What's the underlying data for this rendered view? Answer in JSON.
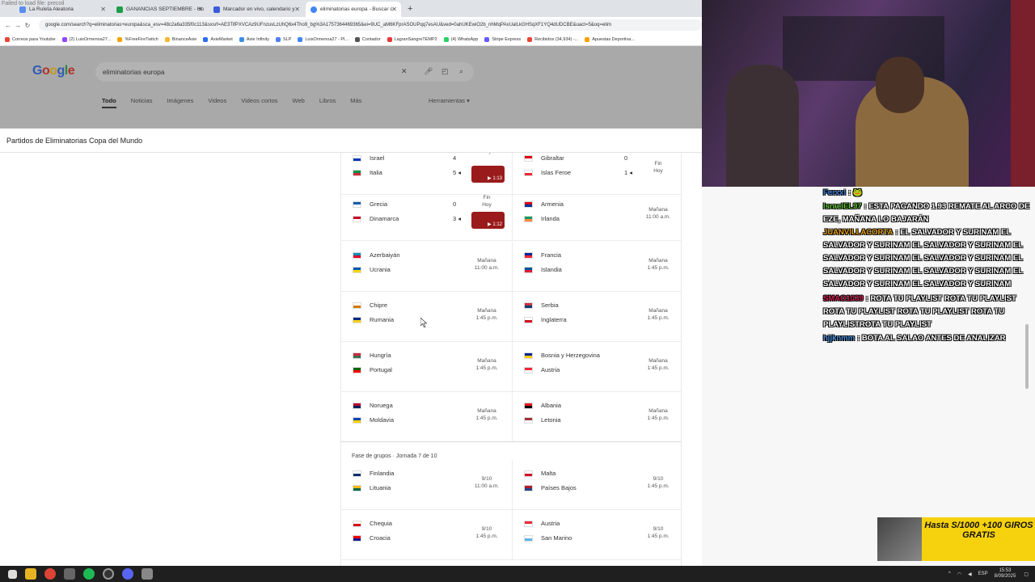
{
  "browser": {
    "failed_notice": "Failed to load file: precoil",
    "tabs": [
      {
        "label": "La Ruleta Aleatoria",
        "color": "#5b8def"
      },
      {
        "label": "GANANCIAS SEPTIEMBRE - Ho",
        "color": "#1e9e4a"
      },
      {
        "label": "Marcador en vivo, calendario y",
        "color": "#3b5bdb"
      },
      {
        "label": "eliminatorias europa - Buscar c",
        "color": "#4285f4"
      }
    ],
    "new_tab": "+",
    "url": "google.com/search?q=eliminatorias+europa&sca_esv=48c2a6a335f0c113&sxsrf=AE3TifPXVCAz9UFnzuvLzUhQ6x4Tho9_bg%3A1757364469365&ei=9UC_aM6KFprASOUPqq7esAU&ved=0ahUKEwiO2b_nhMqPAxUalLkGHSqXF1YQ4dUDCBE&uact=5&oq=elim",
    "bookmarks": [
      {
        "label": "Correos para Youtube",
        "color": "#ea4335"
      },
      {
        "label": "(2) LuisOrmenoa27...",
        "color": "#9146ff"
      },
      {
        "label": "%FreeFireTwitch",
        "color": "#f4a300"
      },
      {
        "label": "BinanceAxie",
        "color": "#f3ba2f"
      },
      {
        "label": "AxieMarket",
        "color": "#2a6df4"
      },
      {
        "label": "Axie Infinity",
        "color": "#3a8ee6"
      },
      {
        "label": "SLP",
        "color": "#4f7ff0"
      },
      {
        "label": "LuisOrmenoa27 - Pl...",
        "color": "#4285f4"
      },
      {
        "label": "Contador",
        "color": "#555555"
      },
      {
        "label": "LagranSangreTEMP2",
        "color": "#e53935"
      },
      {
        "label": "(4) WhatsApp",
        "color": "#25d366"
      },
      {
        "label": "Stripe Express",
        "color": "#635bff"
      },
      {
        "label": "Recibidos (34,934) -...",
        "color": "#ea4335"
      },
      {
        "label": "Apuestas Deportiva...",
        "color": "#f4a300"
      }
    ]
  },
  "google": {
    "logo": "Google",
    "query": "eliminatorias europa",
    "tabs": [
      "Todo",
      "Noticias",
      "Imágenes",
      "Videos",
      "Videos cortos",
      "Web",
      "Libros",
      "Más"
    ],
    "tools": "Herramientas ▾",
    "panel_title": "Partidos de Eliminatorias Copa del Mundo",
    "phase_label": "Fase de grupos · Jornada 7 de 10",
    "matches": [
      {
        "left": {
          "t1": "Israel",
          "f1": [
            "#ffffff",
            "#0038b8"
          ],
          "s1": "4",
          "t2": "Italia",
          "f2": [
            "#009246",
            "#ce2b37"
          ],
          "s2": "5 ◂",
          "time": "Hoy",
          "thumb": "▶ 1:13"
        },
        "right": {
          "t1": "Gibraltar",
          "f1": [
            "#da000c",
            "#ffffff"
          ],
          "s1": "0",
          "t2": "Islas Feroe",
          "f2": [
            "#ffffff",
            "#ed2939"
          ],
          "s2": "1 ◂",
          "time": "Fin\nHoy"
        }
      },
      {
        "left": {
          "t1": "Grecia",
          "f1": [
            "#0d5eaf",
            "#ffffff"
          ],
          "s1": "0",
          "t2": "Dinamarca",
          "f2": [
            "#c8102e",
            "#ffffff"
          ],
          "s2": "3 ◂",
          "time": "Fin\nHoy",
          "thumb": "▶ 1:12"
        },
        "right": {
          "t1": "Armenia",
          "f1": [
            "#d90012",
            "#0033a0"
          ],
          "t2": "Irlanda",
          "f2": [
            "#169b62",
            "#ff883e"
          ],
          "time": "Mañana\n11:00 a.m."
        }
      },
      {
        "left": {
          "t1": "Azerbaiyán",
          "f1": [
            "#0092bc",
            "#e4002b"
          ],
          "t2": "Ucrania",
          "f2": [
            "#0057b7",
            "#ffd700"
          ],
          "time": "Mañana\n11:00 a.m."
        },
        "right": {
          "t1": "Francia",
          "f1": [
            "#002395",
            "#ed2939"
          ],
          "t2": "Islandia",
          "f2": [
            "#02529c",
            "#dc1e35"
          ],
          "time": "Mañana\n1:45 p.m."
        }
      },
      {
        "left": {
          "t1": "Chipre",
          "f1": [
            "#ffffff",
            "#d57800"
          ],
          "t2": "Rumania",
          "f2": [
            "#002b7f",
            "#fcd116"
          ],
          "time": "Mañana\n1:45 p.m."
        },
        "right": {
          "t1": "Serbia",
          "f1": [
            "#c6363c",
            "#0c4076"
          ],
          "t2": "Inglaterra",
          "f2": [
            "#ffffff",
            "#ce1124"
          ],
          "time": "Mañana\n1:45 p.m."
        }
      },
      {
        "left": {
          "t1": "Hungría",
          "f1": [
            "#cd2a3e",
            "#436f4d"
          ],
          "t2": "Portugal",
          "f2": [
            "#006600",
            "#ff0000"
          ],
          "time": "Mañana\n1:45 p.m."
        },
        "right": {
          "t1": "Bosnia y Herzegovina",
          "f1": [
            "#002395",
            "#fecb00"
          ],
          "t2": "Austria",
          "f2": [
            "#ed2939",
            "#ffffff"
          ],
          "time": "Mañana\n1:45 p.m."
        }
      },
      {
        "left": {
          "t1": "Noruega",
          "f1": [
            "#ba0c2f",
            "#00205b"
          ],
          "t2": "Moldavia",
          "f2": [
            "#0046ae",
            "#ffd200"
          ],
          "time": "Mañana\n1:45 p.m."
        },
        "right": {
          "t1": "Albania",
          "f1": [
            "#e41e20",
            "#000000"
          ],
          "t2": "Letonia",
          "f2": [
            "#9e3039",
            "#ffffff"
          ],
          "time": "Mañana\n1:45 p.m."
        }
      },
      {
        "left": {
          "t1": "Finlandia",
          "f1": [
            "#ffffff",
            "#002f6c"
          ],
          "t2": "Lituania",
          "f2": [
            "#fdb913",
            "#006a44"
          ],
          "time": "9/10\n11:00 a.m."
        },
        "right": {
          "t1": "Malta",
          "f1": [
            "#ffffff",
            "#cf142b"
          ],
          "t2": "Países Bajos",
          "f2": [
            "#ae1c28",
            "#21468b"
          ],
          "time": "9/10\n1:45 p.m."
        }
      },
      {
        "left": {
          "t1": "Chequia",
          "f1": [
            "#ffffff",
            "#d7141a"
          ],
          "t2": "Croacia",
          "f2": [
            "#ff0000",
            "#171796"
          ],
          "time": "9/10\n1:45 p.m."
        },
        "right": {
          "t1": "Austria",
          "f1": [
            "#ed2939",
            "#ffffff"
          ],
          "t2": "San Marino",
          "f2": [
            "#ffffff",
            "#5eb6e4"
          ],
          "time": "9/10\n1:45 p.m."
        }
      }
    ]
  },
  "chat": {
    "messages": [
      {
        "user": "Ferxxi",
        "user_color": "#3a7bd5",
        "text": ": 🐸"
      },
      {
        "user": "IsraelEL97",
        "user_color": "#5fbf3a",
        "text": ": ESTA PAGANDO 1.93 REMATE AL ARCO DE EZE, MAÑANA LO BAJARÁN"
      },
      {
        "user": "JUANVILLACORTA",
        "user_color": "#e8a317",
        "text": ": EL SALVADOR Y SURINAM EL SALVADOR Y SURINAM EL SALVADOR Y SURINAM EL SALVADOR Y SURINAM EL SALVADOR Y SURINAM EL SALVADOR Y SURINAM EL SALVADOR Y SURINAM EL SALVADOR Y SURINAM EL SALVADOR Y SURINAM"
      },
      {
        "user": "SMAO1039",
        "user_color": "#d02050",
        "text": ": ROTA TU PLAYLIST ROTA TU PLAYLIST ROTA TU PLAYLIST ROTA TU PLAYLIST ROTA TU PLAYLISTROTA TU PLAYLIST"
      },
      {
        "user": "hjjknmm",
        "user_color": "#4a90d9",
        "text": ": BOTA AL SALAO ANTES DE ANALIZAR"
      }
    ],
    "promo_text": "Hasta S/1000 +100 GIROS GRATIS"
  },
  "taskbar": {
    "time": "15:53",
    "date": "8/09/2025",
    "lang": "ESP"
  }
}
